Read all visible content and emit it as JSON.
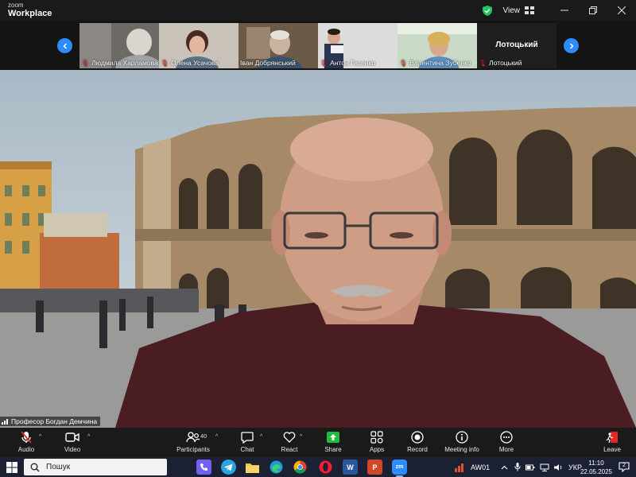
{
  "app": {
    "brand_small": "zoom",
    "brand_main": "Workplace"
  },
  "titlebar": {
    "view_label": "View",
    "shield_color": "#22c55e"
  },
  "gallery": {
    "prev_label": "<",
    "next_label": ">",
    "tiles": [
      {
        "name": "Людмила Харламова",
        "muted": true
      },
      {
        "name": "Олена Усачова",
        "muted": true
      },
      {
        "name": "Іван Добрянський",
        "muted": false
      },
      {
        "name": "Антон Гасенко",
        "muted": true
      },
      {
        "name": "Валентина Зубенко",
        "muted": true
      },
      {
        "name": "Лотоцький",
        "muted": true,
        "avatar_text": "Лотоцький"
      }
    ]
  },
  "stage": {
    "speaker_name": "Професор Богдан Демчина"
  },
  "toolbar": {
    "audio": "Audio",
    "video": "Video",
    "participants": "Participants",
    "participants_count": "40",
    "chat": "Chat",
    "react": "React",
    "share": "Share",
    "apps": "Apps",
    "record": "Record",
    "meeting_info": "Meeting info",
    "more": "More",
    "leave": "Leave",
    "accent": "#2d8cff",
    "share_color": "#1bbf3c",
    "leave_color": "#e02828"
  },
  "taskbar": {
    "search_placeholder": "Пошук",
    "tray_label": "AW01",
    "language": "УКР",
    "time": "11:10",
    "date": "22.05.2025",
    "notif_count": "2",
    "apps": [
      "viber-icon",
      "telegram-icon",
      "file-explorer-icon",
      "edge-icon",
      "chrome-icon",
      "opera-icon",
      "word-icon",
      "powerpoint-icon",
      "zoom-icon"
    ]
  }
}
